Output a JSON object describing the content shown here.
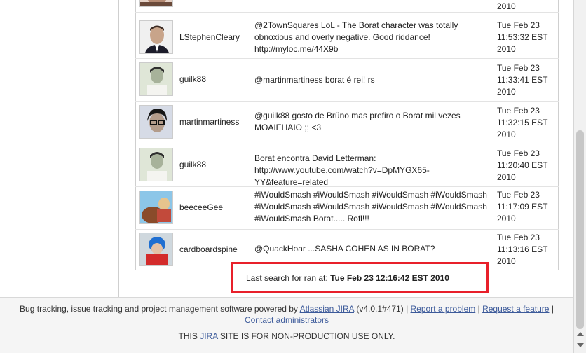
{
  "results": [
    {
      "username": "",
      "tweet": "",
      "date": "2010",
      "avatar_colors": [
        "#b48a73",
        "#6a4a3a",
        "#e6d3c8"
      ]
    },
    {
      "username": "LStephenCleary",
      "tweet": "@2TownSquares LoL - The Borat character was totally obnoxious and overly negative. Good riddance! http://myloc.me/44X9b",
      "date": "Tue Feb 23\n11:53:32 EST\n2010",
      "avatar_colors": [
        "#f0f0f0",
        "#3b2b23",
        "#c8a48a"
      ]
    },
    {
      "username": "guilk88",
      "tweet": "@martinmartiness borat é rei! rs",
      "date": "Tue Feb 23\n11:33:41 EST\n2010",
      "avatar_colors": [
        "#dfe6d7",
        "#2f2f2f",
        "#a7b29a"
      ]
    },
    {
      "username": "martinmartiness",
      "tweet": "@guilk88 gosto de Brüno mas prefiro o Borat mil vezes MOAIEHAIO ;; <3",
      "date": "Tue Feb 23\n11:32:15 EST\n2010",
      "avatar_colors": [
        "#d6dbe6",
        "#161616",
        "#b39c8b"
      ]
    },
    {
      "username": "guilk88",
      "tweet": "Borat encontra David Letterman: http://www.youtube.com/watch?v=DpMYGX65-YY&feature=related",
      "date": "Tue Feb 23\n11:20:40 EST\n2010",
      "avatar_colors": [
        "#dfe6d7",
        "#2f2f2f",
        "#a7b29a"
      ]
    },
    {
      "username": "beeceeGee",
      "tweet": "#iWouldSmash #iWouldSmash #iWouldSmash #iWouldSmash #iWouldSmash #iWouldSmash #iWouldSmash #iWouldSmash #iWouldSmash Borat..... Rofl!!!",
      "date": "Tue Feb 23\n11:17:09 EST\n2010",
      "avatar_colors": [
        "#8cc6e8",
        "#8a4b2a",
        "#e7c48d"
      ]
    },
    {
      "username": "cardboardspine",
      "tweet": "@QuackHoar ...SASHA COHEN AS IN BORAT?",
      "date": "Tue Feb 23\n11:13:16 EST\n2010",
      "avatar_colors": [
        "#cfd8de",
        "#d32b2b",
        "#1f6fd1"
      ]
    }
  ],
  "last_search": {
    "prefix": "Last search for ran at:",
    "timestamp": "Tue Feb 23 12:16:42 EST 2010"
  },
  "footer": {
    "powered_text": "Bug tracking, issue tracking and project management software powered by",
    "jira_link": "Atlassian JIRA",
    "version": "(v4.0.1#471)",
    "sep1": "|",
    "report_problem": "Report a problem",
    "sep2": "|",
    "request_feature": "Request a feature",
    "sep3": "|",
    "contact_admins": "Contact administrators",
    "notice_before": "THIS",
    "notice_link": "JIRA",
    "notice_after": "SITE IS FOR NON-PRODUCTION USE ONLY."
  },
  "colors": {
    "highlight_border": "#e8202a",
    "link": "#3c5a9a",
    "footer_bg": "#f5f5f5"
  }
}
